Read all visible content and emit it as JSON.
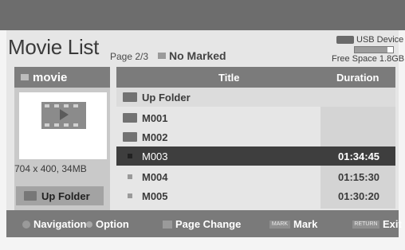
{
  "header": {
    "title": "Movie List",
    "page": "Page 2/3",
    "marked": "No Marked",
    "device": "USB Device",
    "free_space": "Free Space 1.8GB",
    "device_usage": 0.85
  },
  "left": {
    "folder": "movie",
    "info": "704 x 400, 34MB",
    "up_folder_label": "Up Folder"
  },
  "table": {
    "col_title": "Title",
    "col_duration": "Duration",
    "rows": [
      {
        "name": "Up Folder",
        "duration": ""
      },
      {
        "name": "M001",
        "duration": ""
      },
      {
        "name": "M002",
        "duration": ""
      },
      {
        "name": "M003",
        "duration": "01:34:45"
      },
      {
        "name": "M004",
        "duration": "01:15:30"
      },
      {
        "name": "M005",
        "duration": "01:30:20"
      }
    ]
  },
  "footer": {
    "navigation": "Navigation",
    "option": "Option",
    "page_change": "Page Change",
    "mark_key": "MARK",
    "mark": "Mark",
    "return_key": "RETURN",
    "exit": "Exit"
  },
  "colors": {
    "selected_row": "#3e3e3e",
    "header_bar": "#7b7b7b"
  }
}
